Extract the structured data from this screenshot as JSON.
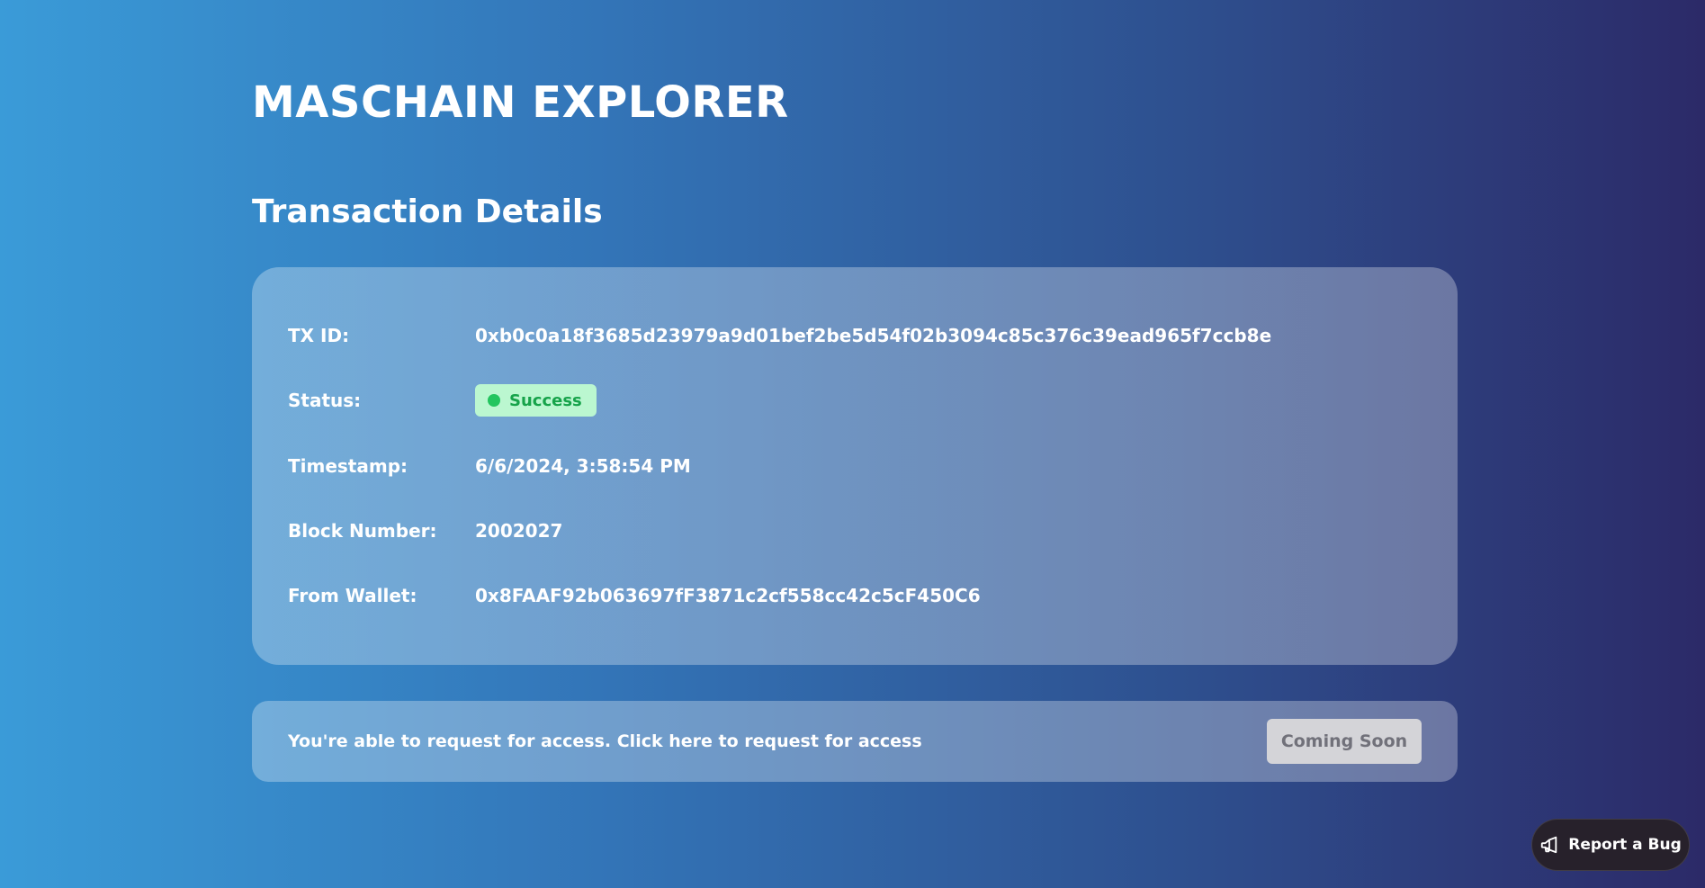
{
  "brand": {
    "title": "MASCHAIN EXPLORER"
  },
  "page": {
    "title": "Transaction Details"
  },
  "details": {
    "rows": [
      {
        "label": "TX ID:",
        "value": "0xb0c0a18f3685d23979a9d01bef2be5d54f02b3094c85c376c39ead965f7ccb8e"
      },
      {
        "label": "Status:",
        "value": "Success"
      },
      {
        "label": "Timestamp:",
        "value": "6/6/2024, 3:58:54 PM"
      },
      {
        "label": "Block Number:",
        "value": "2002027"
      },
      {
        "label": "From Wallet:",
        "value": "0x8FAAF92b063697fF3871c2cf558cc42c5cF450C6"
      }
    ]
  },
  "access": {
    "text": "You're able to request for access. Click here to request for access",
    "button_label": "Coming Soon"
  },
  "report_bug": {
    "label": "Report a Bug",
    "icon": "megaphone-icon"
  },
  "colors": {
    "status_bg": "#bbf7d0",
    "status_text": "#16a34a",
    "status_dot": "#22c55e",
    "report_bug_bg": "#27212b"
  }
}
